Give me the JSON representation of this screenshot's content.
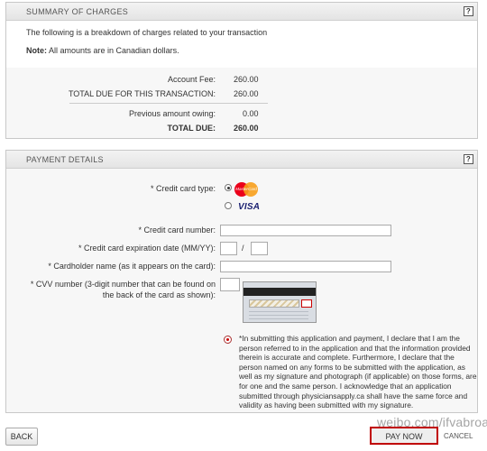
{
  "summary": {
    "title": "SUMMARY OF CHARGES",
    "help": "?",
    "intro": "The following is a breakdown of charges related to your transaction",
    "note_label": "Note:",
    "note_text": " All amounts are in Canadian dollars.",
    "rows": [
      {
        "label": "Account Fee:",
        "value": "260.00"
      },
      {
        "label": "TOTAL DUE FOR THIS TRANSACTION:",
        "value": "260.00"
      },
      {
        "label": "Previous amount owing:",
        "value": "0.00"
      },
      {
        "label": "TOTAL DUE:",
        "value": "260.00"
      }
    ]
  },
  "payment": {
    "title": "PAYMENT DETAILS",
    "help": "?",
    "card_type_label": "* Credit card type:",
    "mastercard_text": "MasterCard",
    "visa_text": "VISA",
    "card_number_label": "* Credit card number:",
    "card_number_value": "",
    "expiration_label": "* Credit card expiration date (MM/YY):",
    "expiration_sep": "/",
    "expiration_month": "",
    "expiration_year": "",
    "holder_label": "* Cardholder name (as it appears on the card):",
    "holder_value": "",
    "cvv_label_1": "* CVV number (3-digit number that can be found on",
    "cvv_label_2": "the back of the card as shown):",
    "cvv_value": "",
    "declaration": "*In submitting this application and payment, I declare that I am the person referred to in the application and that the information provided therein is accurate and complete. Furthermore, I declare that the person named on any forms to be submitted with the application, as well as my signature and photograph (if applicable) on those forms, are for one and the same person. I acknowledge that an application submitted through physiciansapply.ca shall have the same force and validity as having been submitted with my signature."
  },
  "buttons": {
    "back": "BACK",
    "pay_now": "PAY NOW",
    "cancel": "CANCEL"
  },
  "watermark": "weibo.com/ifvabroad"
}
